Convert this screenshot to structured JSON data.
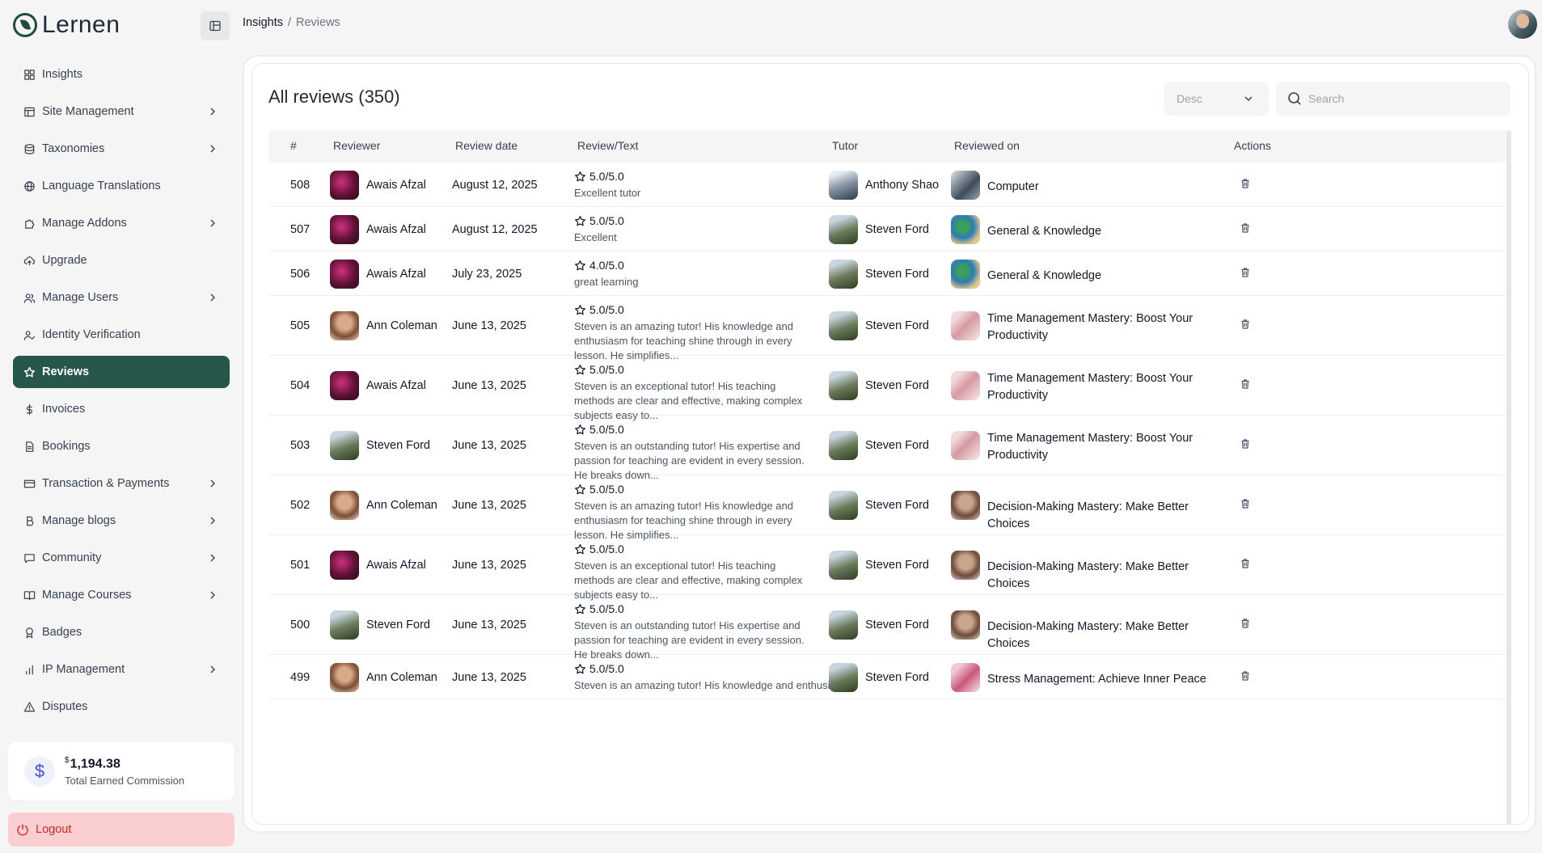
{
  "app": {
    "name": "Lernen"
  },
  "breadcrumb": {
    "parent": "Insights",
    "separator": "/",
    "current": "Reviews"
  },
  "sidebar": {
    "items": [
      {
        "label": "Insights",
        "icon": "grid-icon",
        "chevron": false,
        "active": false
      },
      {
        "label": "Site Management",
        "icon": "layout-icon",
        "chevron": true,
        "active": false
      },
      {
        "label": "Taxonomies",
        "icon": "database-icon",
        "chevron": true,
        "active": false
      },
      {
        "label": "Language Translations",
        "icon": "globe-icon",
        "chevron": false,
        "active": false
      },
      {
        "label": "Manage Addons",
        "icon": "puzzle-icon",
        "chevron": true,
        "active": false
      },
      {
        "label": "Upgrade",
        "icon": "cloud-upload-icon",
        "chevron": false,
        "active": false
      },
      {
        "label": "Manage Users",
        "icon": "users-icon",
        "chevron": true,
        "active": false
      },
      {
        "label": "Identity Verification",
        "icon": "user-check-icon",
        "chevron": false,
        "active": false
      },
      {
        "label": "Reviews",
        "icon": "star-icon",
        "chevron": false,
        "active": true
      },
      {
        "label": "Invoices",
        "icon": "dollar-icon",
        "chevron": false,
        "active": false
      },
      {
        "label": "Bookings",
        "icon": "file-icon",
        "chevron": false,
        "active": false
      },
      {
        "label": "Transaction & Payments",
        "icon": "credit-card-icon",
        "chevron": true,
        "active": false
      },
      {
        "label": "Manage blogs",
        "icon": "bold-b-icon",
        "chevron": true,
        "active": false
      },
      {
        "label": "Community",
        "icon": "chat-icon",
        "chevron": true,
        "active": false
      },
      {
        "label": "Manage Courses",
        "icon": "book-icon",
        "chevron": true,
        "active": false
      },
      {
        "label": "Badges",
        "icon": "badge-icon",
        "chevron": false,
        "active": false
      },
      {
        "label": "IP Management",
        "icon": "bar-chart-icon",
        "chevron": true,
        "active": false
      },
      {
        "label": "Disputes",
        "icon": "alert-triangle-icon",
        "chevron": false,
        "active": false
      }
    ],
    "commission": {
      "currency": "$",
      "amount": "1,194.38",
      "label": "Total Earned Commission"
    },
    "logout_label": "Logout"
  },
  "main": {
    "title": "All reviews (350)",
    "sort": {
      "selected": "Desc"
    },
    "search": {
      "placeholder": "Search",
      "value": ""
    },
    "columns": [
      "#",
      "Reviewer",
      "Review date",
      "Review/Text",
      "Tutor",
      "Reviewed on",
      "Actions"
    ],
    "rows": [
      {
        "id": "508",
        "reviewer": "Awais Afzal",
        "reviewer_img": "awais",
        "date": "August 12, 2025",
        "rating": "5.0/5.0",
        "text": "Excellent tutor",
        "tutor": "Anthony Shao",
        "tutor_img": "anthony",
        "course": "Computer",
        "course_img": "computer",
        "lines": 1
      },
      {
        "id": "507",
        "reviewer": "Awais Afzal",
        "reviewer_img": "awais",
        "date": "August 12, 2025",
        "rating": "5.0/5.0",
        "text": "Excellent",
        "tutor": "Steven Ford",
        "tutor_img": "steven",
        "course": "General & Knowledge",
        "course_img": "general",
        "lines": 1
      },
      {
        "id": "506",
        "reviewer": "Awais Afzal",
        "reviewer_img": "awais",
        "date": "July 23, 2025",
        "rating": "4.0/5.0",
        "text": "great learning",
        "tutor": "Steven Ford",
        "tutor_img": "steven",
        "course": "General & Knowledge",
        "course_img": "general",
        "lines": 1
      },
      {
        "id": "505",
        "reviewer": "Ann Coleman",
        "reviewer_img": "ann",
        "date": "June 13, 2025",
        "rating": "5.0/5.0",
        "text": "Steven is an amazing tutor! His knowledge and enthusiasm for teaching shine through in every lesson. He simplifies...",
        "tutor": "Steven Ford",
        "tutor_img": "steven",
        "course": "Time Management Mastery: Boost Your Productivity",
        "course_img": "time",
        "lines": 2
      },
      {
        "id": "504",
        "reviewer": "Awais Afzal",
        "reviewer_img": "awais",
        "date": "June 13, 2025",
        "rating": "5.0/5.0",
        "text": "Steven is an exceptional tutor! His teaching methods are clear and effective, making complex subjects easy to...",
        "tutor": "Steven Ford",
        "tutor_img": "steven",
        "course": "Time Management Mastery: Boost Your Productivity",
        "course_img": "time",
        "lines": 2
      },
      {
        "id": "503",
        "reviewer": "Steven Ford",
        "reviewer_img": "steven",
        "date": "June 13, 2025",
        "rating": "5.0/5.0",
        "text": "Steven is an outstanding tutor! His expertise and passion for teaching are evident in every session. He breaks down...",
        "tutor": "Steven Ford",
        "tutor_img": "steven",
        "course": "Time Management Mastery: Boost Your Productivity",
        "course_img": "time",
        "lines": 2
      },
      {
        "id": "502",
        "reviewer": "Ann Coleman",
        "reviewer_img": "ann",
        "date": "June 13, 2025",
        "rating": "5.0/5.0",
        "text": "Steven is an amazing tutor! His knowledge and enthusiasm for teaching shine through in every lesson. He simplifies...",
        "tutor": "Steven Ford",
        "tutor_img": "steven",
        "course": "Decision-Making Mastery: Make Better Choices",
        "course_img": "decision",
        "lines": 2
      },
      {
        "id": "501",
        "reviewer": "Awais Afzal",
        "reviewer_img": "awais",
        "date": "June 13, 2025",
        "rating": "5.0/5.0",
        "text": "Steven is an exceptional tutor! His teaching methods are clear and effective, making complex subjects easy to...",
        "tutor": "Steven Ford",
        "tutor_img": "steven",
        "course": "Decision-Making Mastery: Make Better Choices",
        "course_img": "decision",
        "lines": 2
      },
      {
        "id": "500",
        "reviewer": "Steven Ford",
        "reviewer_img": "steven",
        "date": "June 13, 2025",
        "rating": "5.0/5.0",
        "text": "Steven is an outstanding tutor! His expertise and passion for teaching are evident in every session. He breaks down...",
        "tutor": "Steven Ford",
        "tutor_img": "steven",
        "course": "Decision-Making Mastery: Make Better Choices",
        "course_img": "decision",
        "lines": 2
      },
      {
        "id": "499",
        "reviewer": "Ann Coleman",
        "reviewer_img": "ann",
        "date": "June 13, 2025",
        "rating": "5.0/5.0",
        "text": "Steven is an amazing tutor! His knowledge and enthusiasm",
        "tutor": "Steven Ford",
        "tutor_img": "steven",
        "course": "Stress Management: Achieve Inner Peace",
        "course_img": "stress",
        "lines": 1
      }
    ]
  },
  "colors": {
    "accent": "#27574a",
    "logout_bg": "#fbcfd2",
    "logout_text": "#dc2626"
  }
}
